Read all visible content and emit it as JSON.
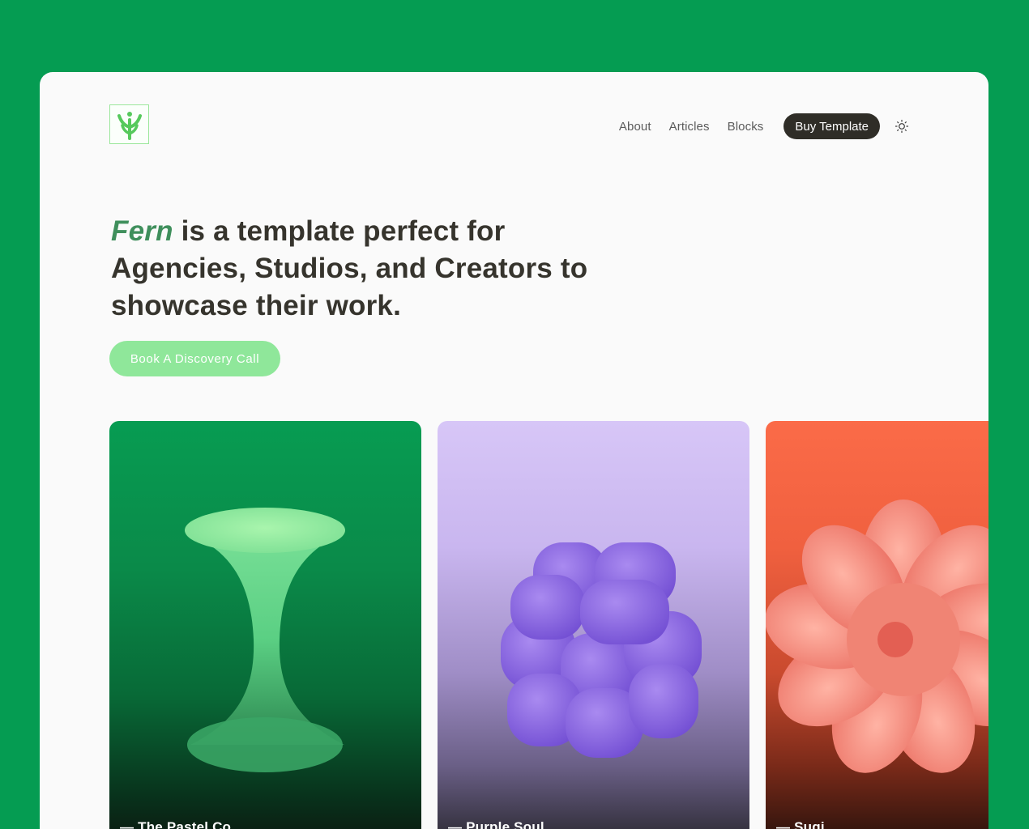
{
  "nav": {
    "items": [
      {
        "label": "About"
      },
      {
        "label": "Articles"
      },
      {
        "label": "Blocks"
      }
    ],
    "buy_label": "Buy Template",
    "theme_icon": "sun-icon"
  },
  "logo": {
    "icon": "fern-logo-icon"
  },
  "hero": {
    "brand": "Fern",
    "headline_rest": " is a template perfect for Agencies, Studios, and Creators to showcase their work.",
    "cta_label": "Book A Discovery Call"
  },
  "projects": [
    {
      "label": "— The Pastel Co.",
      "color": "#079c52"
    },
    {
      "label": "— Purple Soul",
      "color": "#d7c6f7"
    },
    {
      "label": "— Sugi",
      "color": "#fb6b48"
    }
  ],
  "colors": {
    "page_bg": "#059c52",
    "window_bg": "#fafafa",
    "brand_green": "#3f8f5c",
    "cta_bg": "#8fe79a",
    "dark_button": "#2f2d27"
  }
}
